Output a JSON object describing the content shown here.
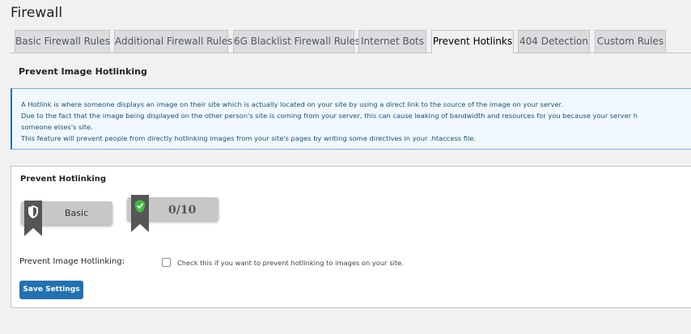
{
  "page": {
    "title": "Firewall"
  },
  "tabs": [
    {
      "label": "Basic Firewall Rules",
      "active": false
    },
    {
      "label": "Additional Firewall Rules",
      "active": false
    },
    {
      "label": "6G Blacklist Firewall Rules",
      "active": false
    },
    {
      "label": "Internet Bots",
      "active": false
    },
    {
      "label": "Prevent Hotlinks",
      "active": true
    },
    {
      "label": "404 Detection",
      "active": false
    },
    {
      "label": "Custom Rules",
      "active": false
    }
  ],
  "section": {
    "heading": "Prevent Image Hotlinking"
  },
  "info": {
    "lines": [
      "A Hotlink is where someone displays an image on their site which is actually located on your site by using a direct link to the source of the image on your server.",
      "Due to the fact that the image being displayed on the other person's site is coming from your server, this can cause leaking of bandwidth and resources for you because your server h",
      "someone elses's site.",
      "This feature will prevent people from directly hotlinking images from your site's pages by writing some directives in your .htaccess file."
    ]
  },
  "panel": {
    "title": "Prevent Hotlinking",
    "level_badge": {
      "label": "Basic",
      "icon": "shield-icon"
    },
    "score_badge": {
      "label": "0/10",
      "icon": "shield-check-icon",
      "accent": "#3dbb3d"
    },
    "option_label": "Prevent Image Hotlinking:",
    "checkbox": {
      "checked": false,
      "description": "Check this if you want to prevent hotlinking to images on your site."
    },
    "save_label": "Save Settings"
  },
  "colors": {
    "primary": "#2271b1",
    "info_bg": "#f0f8fd",
    "info_border": "#72aee6"
  }
}
